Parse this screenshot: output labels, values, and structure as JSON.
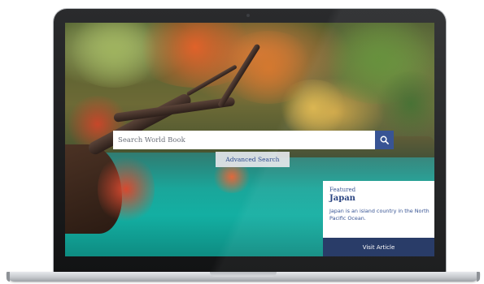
{
  "search": {
    "placeholder": "Search World Book",
    "button_icon": "search-icon",
    "advanced_label": "Advanced Search"
  },
  "featured": {
    "label": "Featured",
    "title": "Japan",
    "description": "Japan is an island country in the North Pacific Ocean.",
    "button_label": "Visit Article"
  },
  "colors": {
    "accent": "#2d4b8e",
    "dark_accent": "#1e3160"
  }
}
